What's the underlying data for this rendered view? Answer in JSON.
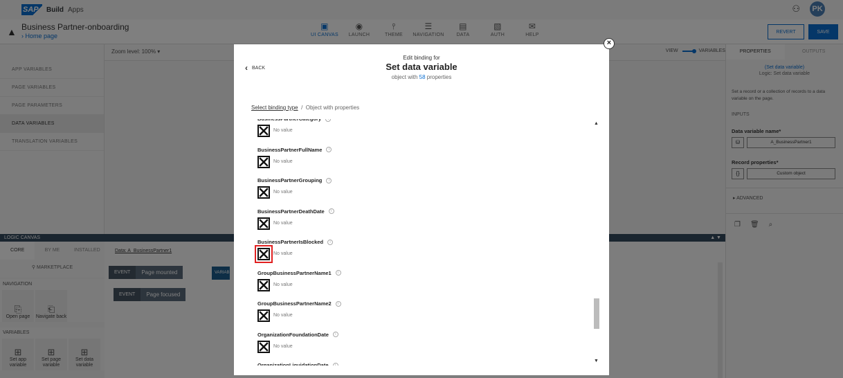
{
  "topbar": {
    "brand": "SAP",
    "build": "Build",
    "apps": "Apps",
    "avatar": "PK"
  },
  "app": {
    "title": "Business Partner-onboarding",
    "breadcrumb": "Home page"
  },
  "nav_tabs": [
    {
      "label": "UI CANVAS",
      "icon": "ui-canvas-icon",
      "glyph": "▣"
    },
    {
      "label": "LAUNCH",
      "icon": "launch-icon",
      "glyph": "◉"
    },
    {
      "label": "THEME",
      "icon": "theme-icon",
      "glyph": "⫯"
    },
    {
      "label": "NAVIGATION",
      "icon": "navigation-icon",
      "glyph": "☰"
    },
    {
      "label": "DATA",
      "icon": "data-icon",
      "glyph": "▤"
    },
    {
      "label": "AUTH",
      "icon": "auth-icon",
      "glyph": "▧"
    },
    {
      "label": "HELP",
      "icon": "help-icon",
      "glyph": "✉"
    }
  ],
  "actions": {
    "revert": "REVERT",
    "save": "SAVE"
  },
  "left_panel": {
    "items": [
      "APP VARIABLES",
      "PAGE VARIABLES",
      "PAGE PARAMETERS",
      "DATA VARIABLES",
      "TRANSLATION VARIABLES"
    ]
  },
  "canvas": {
    "zoom_label": "Zoom level:",
    "zoom_value": "100%",
    "view": "VIEW",
    "variables": "VARIABLES"
  },
  "logic": {
    "title": "LOGIC CANVAS",
    "tabs": [
      "CORE",
      "BY ME",
      "INSTALLED"
    ],
    "marketplace": "MARKETPLACE",
    "data_tab": "Data: A_BusinessPartner1",
    "nav_heading": "NAVIGATION",
    "nav_tiles": [
      "Open page",
      "Navigate back"
    ],
    "var_heading": "VARIABLES",
    "var_tiles": [
      "Set app variable",
      "Set page variable",
      "Set data variable"
    ],
    "event_label": "EVENT",
    "event1": "Page mounted",
    "event2": "Page focused",
    "var_chip": "VARIAB"
  },
  "right_panel": {
    "tabs": [
      "PROPERTIES",
      "OUTPUTS"
    ],
    "link": "(Set data variable)",
    "logic": "Logic: Set data variable",
    "desc": "Set a record or a collection of records to a data variable on the page.",
    "inputs": "INPUTS",
    "dv_label": "Data variable name*",
    "dv_value": "A_BusinessPartner1",
    "rp_label": "Record properties*",
    "rp_value": "Custom object",
    "advanced": "ADVANCED"
  },
  "modal": {
    "pre": "Edit binding for",
    "title": "Set data variable",
    "sub_prefix": "object with ",
    "sub_count": "58",
    "sub_suffix": " properties",
    "back": "BACK",
    "crumb_link": "Select binding type",
    "crumb_sep": "/",
    "crumb_current": "Object with properties",
    "no_value": "No value",
    "properties": [
      "BusinessPartnerCategory",
      "BusinessPartnerFullName",
      "BusinessPartnerGrouping",
      "BusinessPartnerDeathDate",
      "BusinessPartnerIsBlocked",
      "GroupBusinessPartnerName1",
      "GroupBusinessPartnerName2",
      "OrganizationFoundationDate",
      "OrganizationLiquidationDate"
    ]
  },
  "colors": {
    "accent": "#0a6ed1",
    "highlight": "#e02020",
    "shell": "#354a5f"
  }
}
